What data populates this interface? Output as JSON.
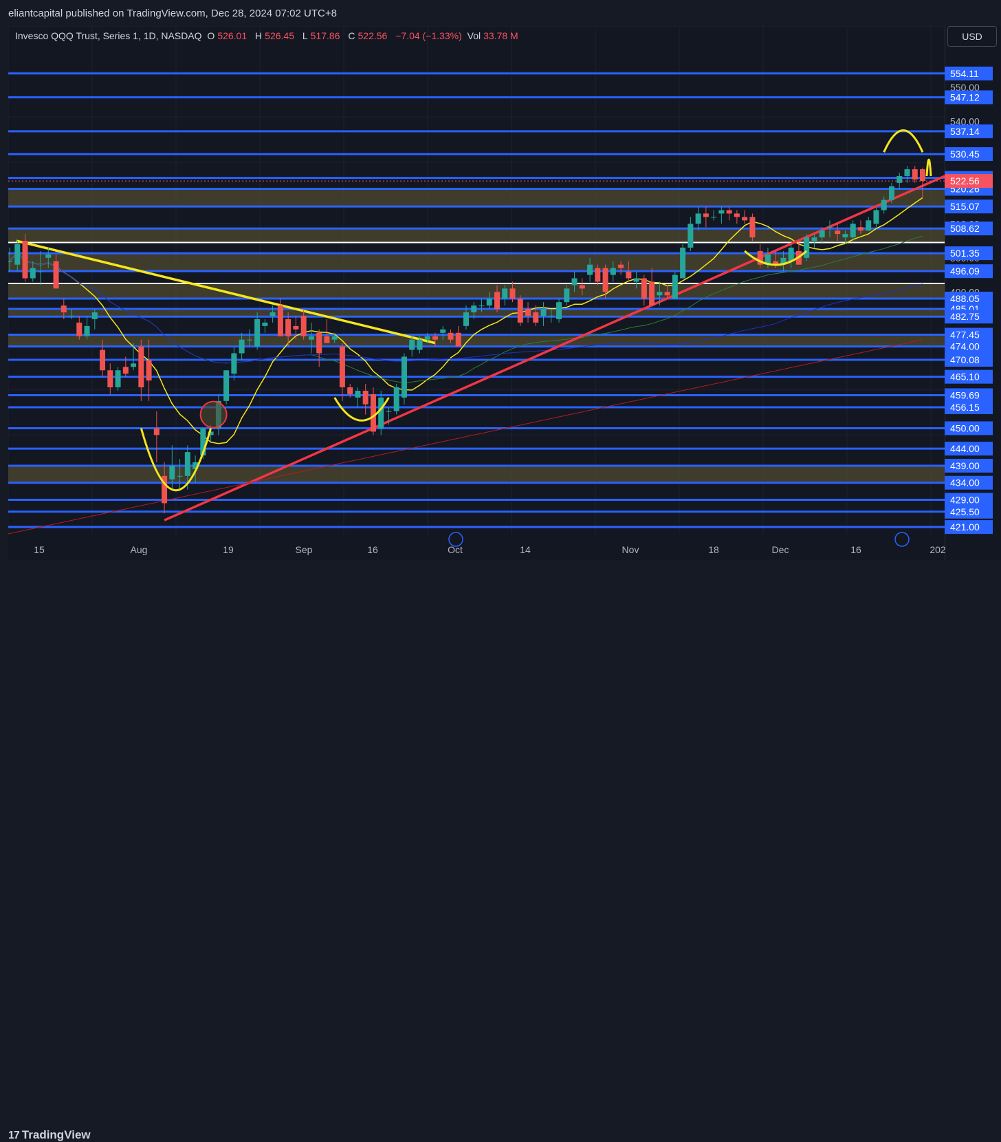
{
  "header": {
    "published": "eliantcapital published on TradingView.com, Dec 28, 2024 07:02 UTC+8"
  },
  "legend": {
    "symbol": "Invesco QQQ Trust, Series 1, 1D, NASDAQ",
    "o_label": "O",
    "o": "526.01",
    "h_label": "H",
    "h": "526.45",
    "l_label": "L",
    "l": "517.86",
    "c_label": "C",
    "c": "522.56",
    "change": "−7.04 (−1.33%)",
    "vol_label": "Vol",
    "vol": "33.78 M"
  },
  "currency": "USD",
  "footer": {
    "brand": "TradingView"
  },
  "colors": {
    "bg": "#131722",
    "blue_level": "#2962ff",
    "white_level": "#ffffff",
    "zone": "#4f4a2f",
    "up": "#26a69a",
    "down": "#ef5350",
    "yellow": "#f5e61b",
    "trend_red": "#f23645",
    "ma_green": "#2e7d32",
    "ma_blue": "#1e2fc7",
    "ma_red": "#b71c1c",
    "price_tag": "#f7525f"
  },
  "chart_data": {
    "type": "candlestick",
    "title": "Invesco QQQ Trust, Series 1, 1D, NASDAQ",
    "ylim": [
      419,
      568
    ],
    "x_ticks": [
      "15",
      "Aug",
      "19",
      "Sep",
      "16",
      "Oct",
      "14",
      "Nov",
      "18",
      "Dec",
      "16",
      "202"
    ],
    "y_ticks": [
      "550.00",
      "540.00",
      "510.00",
      "500.00",
      "490.00"
    ],
    "blue_levels": [
      554.11,
      547.12,
      537.14,
      530.45,
      523.45,
      520.26,
      515.07,
      508.62,
      501.35,
      496.09,
      488.05,
      485.01,
      482.75,
      477.45,
      474.0,
      470.08,
      465.1,
      459.69,
      456.15,
      450.0,
      444.0,
      439.0,
      434.0,
      429.0,
      425.5,
      421.0
    ],
    "level_labels": [
      "554.11",
      "547.12",
      "537.14",
      "530.45",
      "523.45",
      "520.26",
      "515.07",
      "508.62",
      "501.35",
      "496.09",
      "488.05",
      "485.01",
      "482.75",
      "477.45",
      "474.00",
      "470.08",
      "465.10",
      "459.69",
      "456.15",
      "450.00",
      "444.00",
      "439.00",
      "434.00",
      "429.00",
      "425.50",
      "421.00"
    ],
    "last_price": "522.56",
    "zones": [
      [
        434,
        439
      ],
      [
        477.45,
        474
      ],
      [
        482.75,
        485.01
      ],
      [
        488.05,
        492.5
      ],
      [
        496.09,
        501.35
      ],
      [
        508.62,
        504.5
      ],
      [
        515.07,
        520.26
      ]
    ],
    "candles": [
      {
        "date": "2024-07-11",
        "o": 499,
        "h": 503,
        "l": 496,
        "c": 499
      },
      {
        "date": "2024-07-12",
        "o": 498,
        "h": 505,
        "l": 496,
        "c": 504
      },
      {
        "date": "2024-07-15",
        "o": 505,
        "h": 507,
        "l": 493,
        "c": 494
      },
      {
        "date": "2024-07-16",
        "o": 494,
        "h": 499,
        "l": 493,
        "c": 497
      },
      {
        "date": "2024-07-17",
        "o": 496,
        "h": 502,
        "l": 492,
        "c": 496
      },
      {
        "date": "2024-07-18",
        "o": 500,
        "h": 503,
        "l": 497,
        "c": 501
      },
      {
        "date": "2024-07-19",
        "o": 499,
        "h": 501,
        "l": 491,
        "c": 491
      },
      {
        "date": "2024-07-22",
        "o": 486,
        "h": 488,
        "l": 482,
        "c": 484
      },
      {
        "date": "2024-07-23",
        "o": 483,
        "h": 485,
        "l": 482,
        "c": 483
      },
      {
        "date": "2024-07-24",
        "o": 481,
        "h": 483,
        "l": 476,
        "c": 477
      },
      {
        "date": "2024-07-25",
        "o": 477,
        "h": 483,
        "l": 476,
        "c": 480
      },
      {
        "date": "2024-07-26",
        "o": 482,
        "h": 485,
        "l": 479,
        "c": 484
      },
      {
        "date": "2024-07-29",
        "o": 473,
        "h": 476,
        "l": 465,
        "c": 467
      },
      {
        "date": "2024-07-30",
        "o": 467,
        "h": 469,
        "l": 460,
        "c": 462
      },
      {
        "date": "2024-07-31",
        "o": 462,
        "h": 468,
        "l": 461,
        "c": 467
      },
      {
        "date": "2024-08-01",
        "o": 468,
        "h": 471,
        "l": 465,
        "c": 466
      },
      {
        "date": "2024-08-02",
        "o": 468,
        "h": 475,
        "l": 467,
        "c": 469
      },
      {
        "date": "2024-08-05",
        "o": 474,
        "h": 476,
        "l": 458,
        "c": 462
      },
      {
        "date": "2024-08-06",
        "o": 470,
        "h": 476,
        "l": 458,
        "c": 464
      },
      {
        "date": "2024-08-07",
        "o": 450,
        "h": 455,
        "l": 440,
        "c": 448
      },
      {
        "date": "2024-08-08",
        "o": 436,
        "h": 440,
        "l": 425,
        "c": 428
      },
      {
        "date": "2024-08-09",
        "o": 435,
        "h": 445,
        "l": 432,
        "c": 439
      },
      {
        "date": "2024-08-12",
        "o": 436,
        "h": 441,
        "l": 432,
        "c": 436
      },
      {
        "date": "2024-08-13",
        "o": 436,
        "h": 445,
        "l": 432,
        "c": 443
      },
      {
        "date": "2024-08-14",
        "o": 438,
        "h": 442,
        "l": 434,
        "c": 440
      },
      {
        "date": "2024-08-15",
        "o": 442,
        "h": 450,
        "l": 441,
        "c": 450
      },
      {
        "date": "2024-08-16",
        "o": 448,
        "h": 451,
        "l": 446,
        "c": 449
      },
      {
        "date": "2024-08-19",
        "o": 450,
        "h": 460,
        "l": 448,
        "c": 458
      },
      {
        "date": "2024-08-20",
        "o": 458,
        "h": 467,
        "l": 457,
        "c": 467
      },
      {
        "date": "2024-08-21",
        "o": 466,
        "h": 474,
        "l": 464,
        "c": 472
      },
      {
        "date": "2024-08-22",
        "o": 472,
        "h": 478,
        "l": 470,
        "c": 476
      },
      {
        "date": "2024-08-23",
        "o": 476,
        "h": 479,
        "l": 474,
        "c": 476
      },
      {
        "date": "2024-08-26",
        "o": 474,
        "h": 484,
        "l": 473,
        "c": 482
      },
      {
        "date": "2024-08-27",
        "o": 480,
        "h": 482,
        "l": 478,
        "c": 481
      },
      {
        "date": "2024-08-28",
        "o": 483,
        "h": 486,
        "l": 481,
        "c": 484
      },
      {
        "date": "2024-08-29",
        "o": 486,
        "h": 488,
        "l": 477,
        "c": 477
      },
      {
        "date": "2024-08-30",
        "o": 482,
        "h": 484,
        "l": 474,
        "c": 477
      },
      {
        "date": "2024-09-03",
        "o": 480,
        "h": 483,
        "l": 476,
        "c": 479
      },
      {
        "date": "2024-09-04",
        "o": 483,
        "h": 485,
        "l": 476,
        "c": 477
      },
      {
        "date": "2024-09-05",
        "o": 476,
        "h": 481,
        "l": 472,
        "c": 477
      },
      {
        "date": "2024-09-06",
        "o": 478,
        "h": 479,
        "l": 468,
        "c": 472
      },
      {
        "date": "2024-09-09",
        "o": 477,
        "h": 482,
        "l": 475,
        "c": 475
      },
      {
        "date": "2024-09-10",
        "o": 476,
        "h": 478,
        "l": 475,
        "c": 477
      },
      {
        "date": "2024-09-11",
        "o": 474,
        "h": 475,
        "l": 458,
        "c": 462
      },
      {
        "date": "2024-09-12",
        "o": 462,
        "h": 463,
        "l": 459,
        "c": 460
      },
      {
        "date": "2024-09-13",
        "o": 459,
        "h": 462,
        "l": 456,
        "c": 461
      },
      {
        "date": "2024-09-16",
        "o": 461,
        "h": 463,
        "l": 454,
        "c": 457
      },
      {
        "date": "2024-09-17",
        "o": 460,
        "h": 462,
        "l": 448,
        "c": 449
      },
      {
        "date": "2024-09-18",
        "o": 450,
        "h": 461,
        "l": 448,
        "c": 459
      },
      {
        "date": "2024-09-19",
        "o": 455,
        "h": 456,
        "l": 451,
        "c": 455
      },
      {
        "date": "2024-09-20",
        "o": 455,
        "h": 463,
        "l": 454,
        "c": 462
      },
      {
        "date": "2024-09-23",
        "o": 459,
        "h": 472,
        "l": 457,
        "c": 471
      },
      {
        "date": "2024-09-24",
        "o": 473,
        "h": 477,
        "l": 471,
        "c": 476
      },
      {
        "date": "2024-09-25",
        "o": 473,
        "h": 477,
        "l": 472,
        "c": 476
      },
      {
        "date": "2024-09-26",
        "o": 476,
        "h": 478,
        "l": 475,
        "c": 477
      },
      {
        "date": "2024-09-27",
        "o": 477,
        "h": 478,
        "l": 474,
        "c": 476
      },
      {
        "date": "2024-09-30",
        "o": 478,
        "h": 480,
        "l": 476,
        "c": 479
      },
      {
        "date": "2024-10-01",
        "o": 478,
        "h": 479,
        "l": 475,
        "c": 476
      },
      {
        "date": "2024-10-02",
        "o": 478,
        "h": 480,
        "l": 474,
        "c": 474
      },
      {
        "date": "2024-10-03",
        "o": 480,
        "h": 486,
        "l": 479,
        "c": 484
      },
      {
        "date": "2024-10-04",
        "o": 484,
        "h": 487,
        "l": 482,
        "c": 486
      },
      {
        "date": "2024-10-07",
        "o": 486,
        "h": 488,
        "l": 484,
        "c": 486
      },
      {
        "date": "2024-10-08",
        "o": 486,
        "h": 490,
        "l": 485,
        "c": 488
      },
      {
        "date": "2024-10-09",
        "o": 490,
        "h": 492,
        "l": 484,
        "c": 485
      },
      {
        "date": "2024-10-10",
        "o": 488,
        "h": 492,
        "l": 486,
        "c": 491
      },
      {
        "date": "2024-10-11",
        "o": 491,
        "h": 493,
        "l": 487,
        "c": 488
      },
      {
        "date": "2024-10-14",
        "o": 488,
        "h": 489,
        "l": 480,
        "c": 481
      },
      {
        "date": "2024-10-15",
        "o": 485,
        "h": 487,
        "l": 481,
        "c": 483
      },
      {
        "date": "2024-10-16",
        "o": 484,
        "h": 486,
        "l": 480,
        "c": 481
      },
      {
        "date": "2024-10-17",
        "o": 483,
        "h": 487,
        "l": 480,
        "c": 485
      },
      {
        "date": "2024-10-18",
        "o": 483,
        "h": 485,
        "l": 481,
        "c": 483
      },
      {
        "date": "2024-10-21",
        "o": 482,
        "h": 488,
        "l": 481,
        "c": 487
      },
      {
        "date": "2024-10-22",
        "o": 487,
        "h": 492,
        "l": 486,
        "c": 491
      },
      {
        "date": "2024-10-23",
        "o": 492,
        "h": 496,
        "l": 490,
        "c": 494
      },
      {
        "date": "2024-10-24",
        "o": 492,
        "h": 494,
        "l": 489,
        "c": 491
      },
      {
        "date": "2024-10-25",
        "o": 495,
        "h": 500,
        "l": 493,
        "c": 498
      },
      {
        "date": "2024-10-28",
        "o": 497,
        "h": 498,
        "l": 492,
        "c": 493
      },
      {
        "date": "2024-10-29",
        "o": 497,
        "h": 498,
        "l": 488,
        "c": 490
      },
      {
        "date": "2024-10-30",
        "o": 495,
        "h": 499,
        "l": 493,
        "c": 497
      },
      {
        "date": "2024-10-31",
        "o": 498,
        "h": 499,
        "l": 495,
        "c": 497
      },
      {
        "date": "2024-11-01",
        "o": 496,
        "h": 499,
        "l": 493,
        "c": 494
      },
      {
        "date": "2024-11-04",
        "o": 493,
        "h": 496,
        "l": 491,
        "c": 494
      },
      {
        "date": "2024-11-05",
        "o": 494,
        "h": 495,
        "l": 486,
        "c": 488
      },
      {
        "date": "2024-11-06",
        "o": 493,
        "h": 497,
        "l": 486,
        "c": 486
      },
      {
        "date": "2024-11-07",
        "o": 489,
        "h": 493,
        "l": 486,
        "c": 490
      },
      {
        "date": "2024-11-08",
        "o": 490,
        "h": 492,
        "l": 488,
        "c": 489
      },
      {
        "date": "2024-11-11",
        "o": 488,
        "h": 496,
        "l": 488,
        "c": 495
      },
      {
        "date": "2024-11-12",
        "o": 494,
        "h": 504,
        "l": 494,
        "c": 503
      },
      {
        "date": "2024-11-13",
        "o": 503,
        "h": 512,
        "l": 502,
        "c": 510
      },
      {
        "date": "2024-11-14",
        "o": 510,
        "h": 515,
        "l": 508,
        "c": 513
      },
      {
        "date": "2024-11-15",
        "o": 513,
        "h": 515,
        "l": 509,
        "c": 512
      },
      {
        "date": "2024-11-18",
        "o": 512,
        "h": 514,
        "l": 511,
        "c": 512
      },
      {
        "date": "2024-11-19",
        "o": 513,
        "h": 515,
        "l": 510,
        "c": 514
      },
      {
        "date": "2024-11-20",
        "o": 514,
        "h": 515,
        "l": 511,
        "c": 513
      },
      {
        "date": "2024-11-21",
        "o": 513,
        "h": 514,
        "l": 510,
        "c": 512
      },
      {
        "date": "2024-11-22",
        "o": 512,
        "h": 514,
        "l": 510,
        "c": 511
      },
      {
        "date": "2024-11-25",
        "o": 512,
        "h": 513,
        "l": 505,
        "c": 506
      },
      {
        "date": "2024-11-26",
        "o": 502,
        "h": 504,
        "l": 497,
        "c": 498
      },
      {
        "date": "2024-11-27",
        "o": 498,
        "h": 503,
        "l": 497,
        "c": 501
      },
      {
        "date": "2024-11-29",
        "o": 499,
        "h": 502,
        "l": 497,
        "c": 498
      },
      {
        "date": "2024-12-02",
        "o": 498,
        "h": 502,
        "l": 496,
        "c": 500
      },
      {
        "date": "2024-12-03",
        "o": 499,
        "h": 504,
        "l": 497,
        "c": 503
      },
      {
        "date": "2024-12-04",
        "o": 502,
        "h": 505,
        "l": 498,
        "c": 498
      },
      {
        "date": "2024-12-05",
        "o": 500,
        "h": 507,
        "l": 499,
        "c": 506
      },
      {
        "date": "2024-12-06",
        "o": 505,
        "h": 507,
        "l": 503,
        "c": 506
      },
      {
        "date": "2024-12-09",
        "o": 506,
        "h": 509,
        "l": 504,
        "c": 508
      },
      {
        "date": "2024-12-10",
        "o": 509,
        "h": 511,
        "l": 506,
        "c": 509
      },
      {
        "date": "2024-12-11",
        "o": 508,
        "h": 510,
        "l": 505,
        "c": 507
      },
      {
        "date": "2024-12-12",
        "o": 506,
        "h": 508,
        "l": 504,
        "c": 507
      },
      {
        "date": "2024-12-13",
        "o": 506,
        "h": 511,
        "l": 505,
        "c": 510
      },
      {
        "date": "2024-12-16",
        "o": 509,
        "h": 511,
        "l": 507,
        "c": 508
      },
      {
        "date": "2024-12-17",
        "o": 508,
        "h": 512,
        "l": 508,
        "c": 511
      },
      {
        "date": "2024-12-18",
        "o": 510,
        "h": 515,
        "l": 509,
        "c": 514
      },
      {
        "date": "2024-12-19",
        "o": 514,
        "h": 518,
        "l": 513,
        "c": 517
      },
      {
        "date": "2024-12-20",
        "o": 517,
        "h": 522,
        "l": 516,
        "c": 521
      },
      {
        "date": "2024-12-23",
        "o": 522,
        "h": 525,
        "l": 520,
        "c": 524
      },
      {
        "date": "2024-12-24",
        "o": 524,
        "h": 527,
        "l": 522,
        "c": 526
      },
      {
        "date": "2024-12-26",
        "o": 526,
        "h": 527,
        "l": 522,
        "c": 523
      },
      {
        "date": "2024-12-27",
        "o": 526.01,
        "h": 526.45,
        "l": 517.86,
        "c": 522.56
      }
    ]
  }
}
